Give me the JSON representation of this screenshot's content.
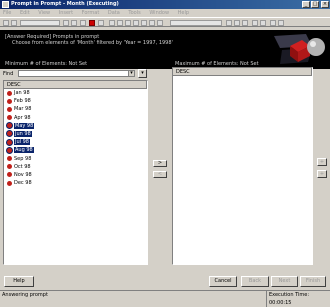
{
  "window": {
    "title": "Prompt in Prompt - Month (Executing)",
    "controls": [
      "_",
      "□",
      "×"
    ]
  },
  "menu": [
    "File",
    "Edit",
    "View",
    "Insert",
    "Format",
    "Data",
    "Tools",
    "Window",
    "Help"
  ],
  "banner": {
    "line1": "[Answer Required] Prompts in prompt",
    "line2": "Choose from elements of 'Month' filtered by 'Year = 1997, 1998'",
    "left_info": "Minimum # of Elements: Not Set",
    "right_info": "Maximum # of Elements: Not Set"
  },
  "find": {
    "label": "Find",
    "value": "",
    "combo_glyph": "▾",
    "button_glyph": "▾"
  },
  "left_list": {
    "header": "DESC",
    "items": [
      {
        "label": "Jan 98",
        "selected": false
      },
      {
        "label": "Feb 98",
        "selected": false
      },
      {
        "label": "Mar 98",
        "selected": false
      },
      {
        "label": "Apr 98",
        "selected": false
      },
      {
        "label": "May 98",
        "selected": true
      },
      {
        "label": "Jun 98",
        "selected": true
      },
      {
        "label": "Jul 98",
        "selected": true
      },
      {
        "label": "Aug 98",
        "selected": true
      },
      {
        "label": "Sep 98",
        "selected": false
      },
      {
        "label": "Oct 98",
        "selected": false
      },
      {
        "label": "Nov 98",
        "selected": false
      },
      {
        "label": "Dec 98",
        "selected": false
      }
    ]
  },
  "right_list": {
    "header": "DESC"
  },
  "move": {
    "add": ">",
    "remove": "<"
  },
  "order": {
    "up": "+",
    "down": "+"
  },
  "buttons": {
    "help": "Help",
    "cancel": "Cancel",
    "back": "Back",
    "next": "Next",
    "finish": "Finish"
  },
  "status": {
    "left": "Answering prompt",
    "right": "Execution Time: 00:00:15"
  },
  "colors": {
    "selection": "#0a246a",
    "title_gradient_start": "#0a246a",
    "element_icon": "#c0201a"
  }
}
